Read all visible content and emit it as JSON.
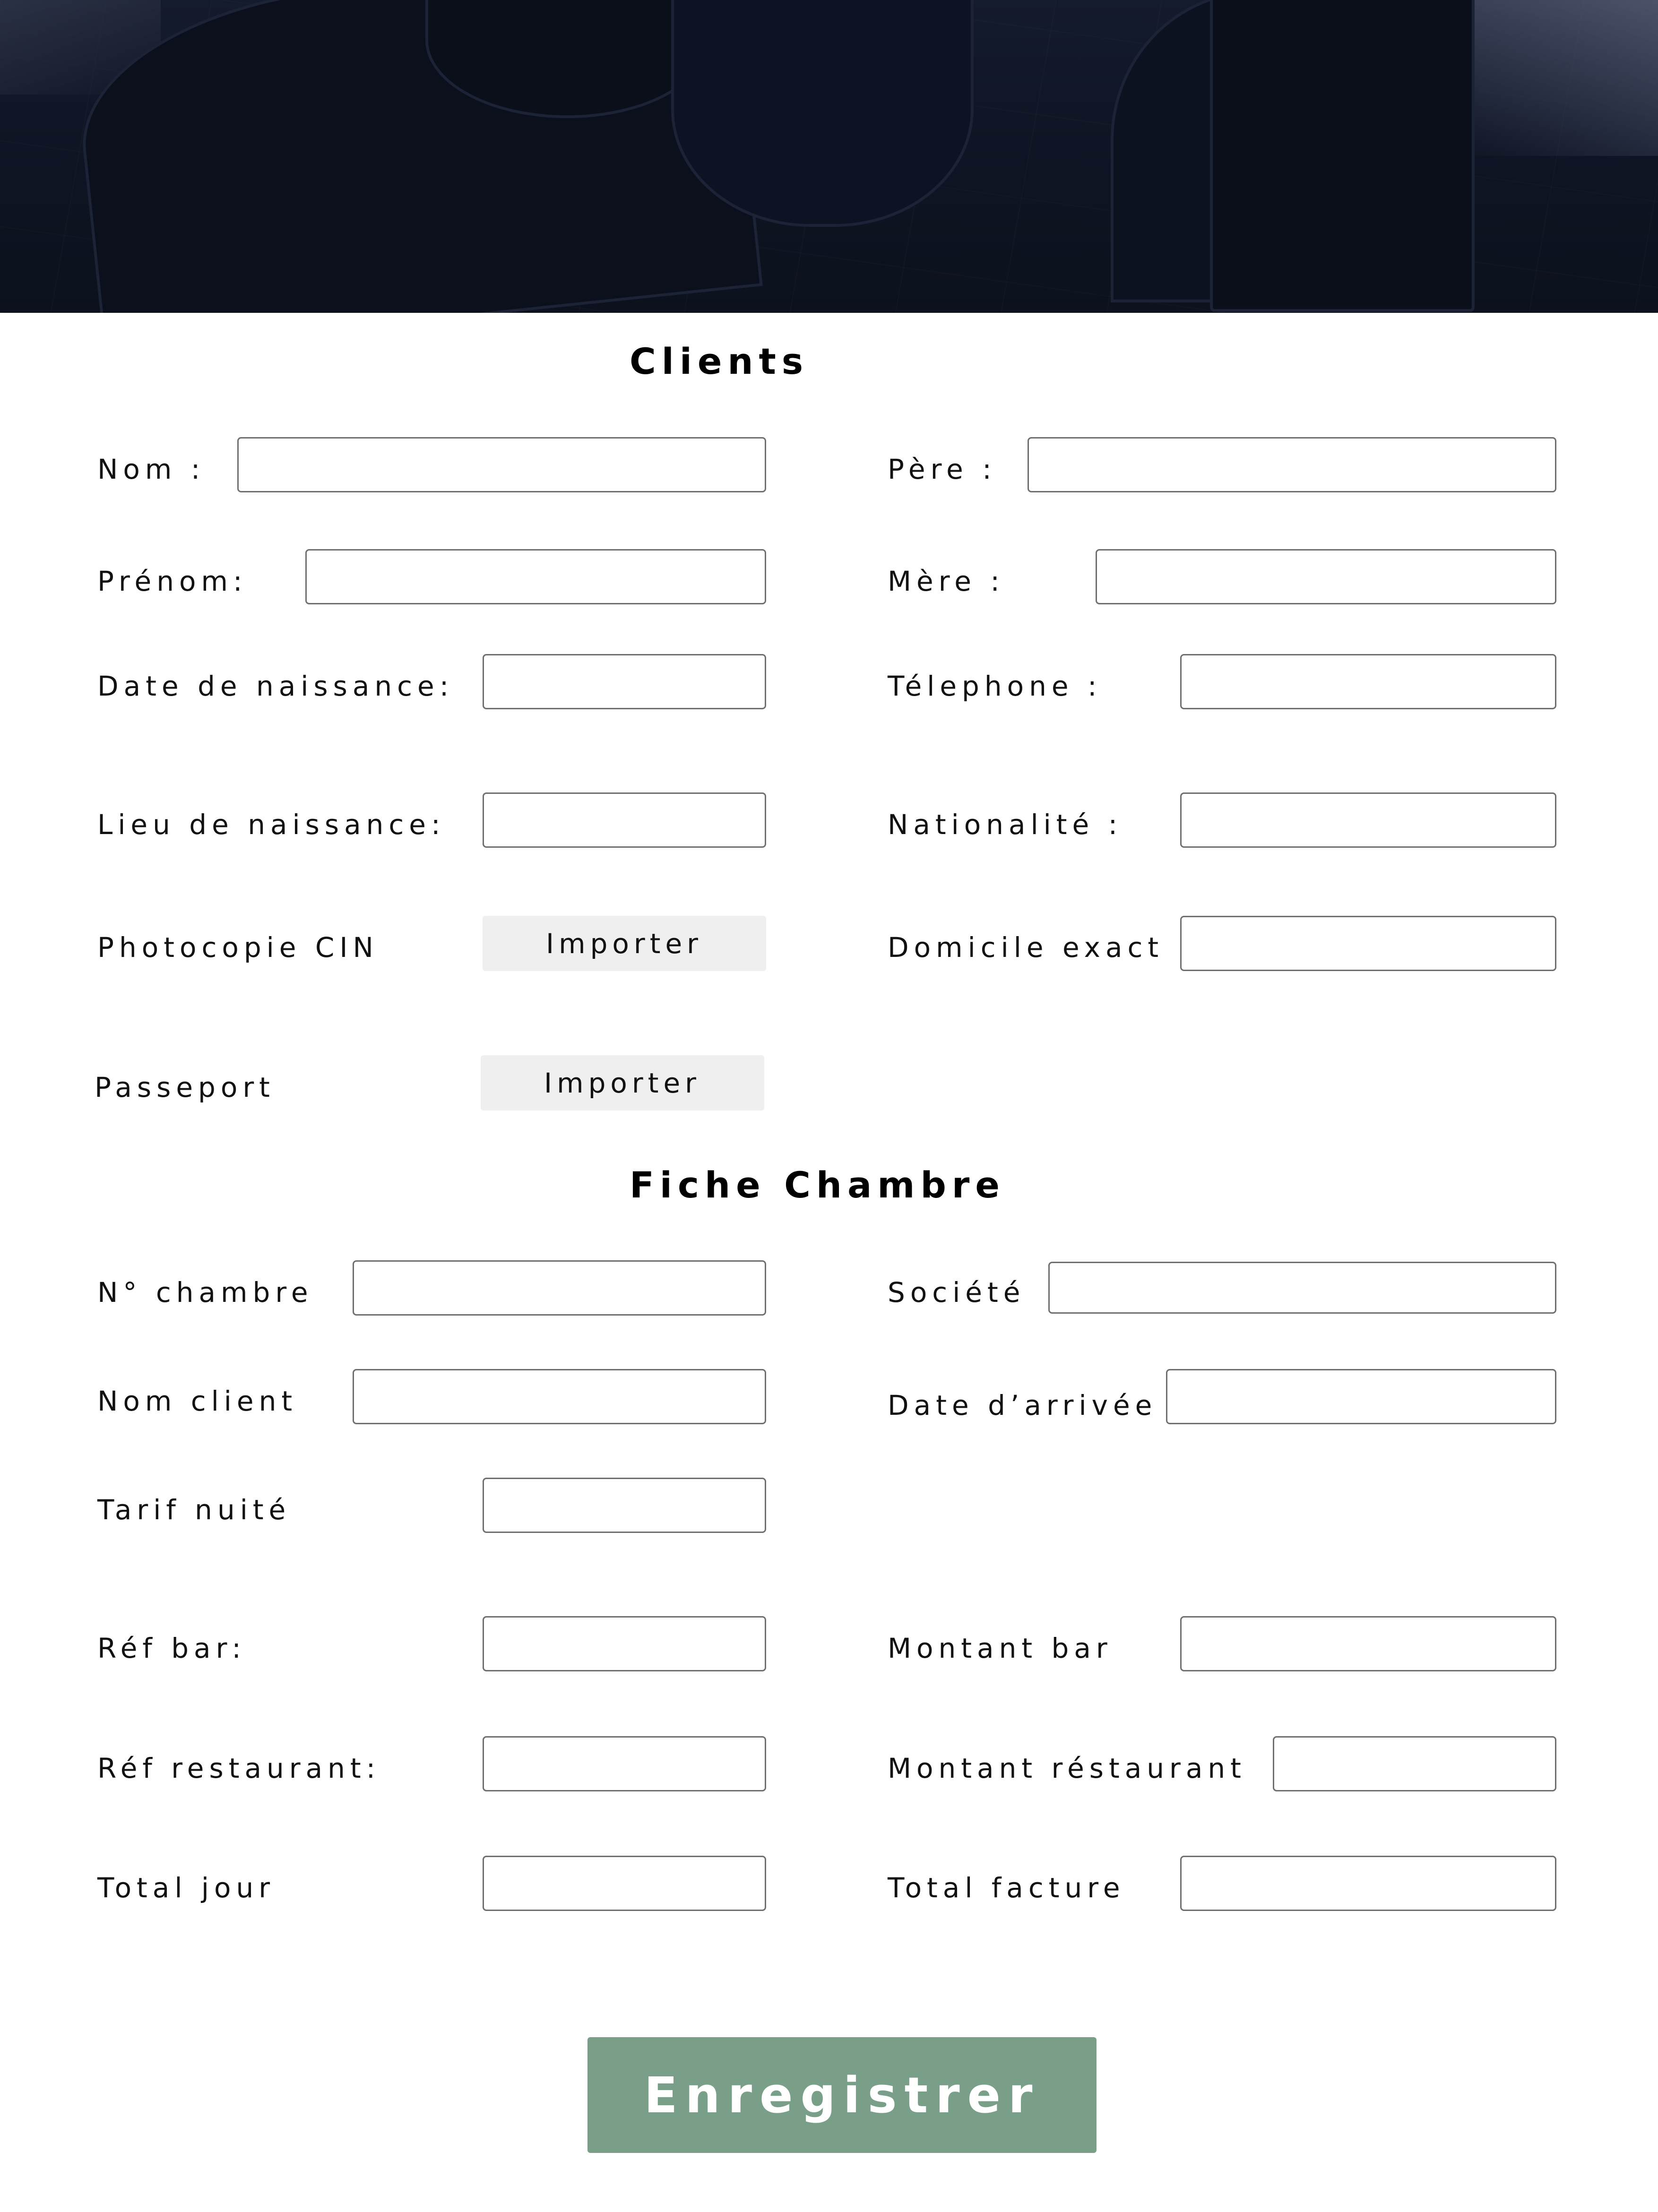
{
  "clients": {
    "title": "Clients",
    "nom_label": "Nom :",
    "pere_label": "Père :",
    "prenom_label": "Prénom:",
    "mere_label": "Mère :",
    "date_naissance_label": "Date de naissance:",
    "telephone_label": "Télephone :",
    "lieu_naissance_label": "Lieu de naissance:",
    "nationalite_label": "Nationalité :",
    "photocopie_cin_label": "Photocopie CIN",
    "domicile_label": "Domicile exact",
    "passeport_label": "Passeport",
    "import_label": "Importer"
  },
  "chambre": {
    "title": "Fiche Chambre",
    "numero_label": "N° chambre",
    "societe_label": "Société",
    "nom_client_label": "Nom client",
    "date_arrivee_label": "Date d’arrivée",
    "tarif_label": "Tarif nuité",
    "ref_bar_label": "Réf bar:",
    "montant_bar_label": "Montant bar",
    "ref_restaurant_label": "Réf restaurant:",
    "montant_restaurant_label": "Montant réstaurant",
    "total_jour_label": "Total jour",
    "total_facture_label": "Total facture"
  },
  "submit_label": "Enregistrer",
  "colors": {
    "submit_bg": "#7a9f89",
    "field_border": "#6f6f6f",
    "upload_bg": "#efefef"
  }
}
